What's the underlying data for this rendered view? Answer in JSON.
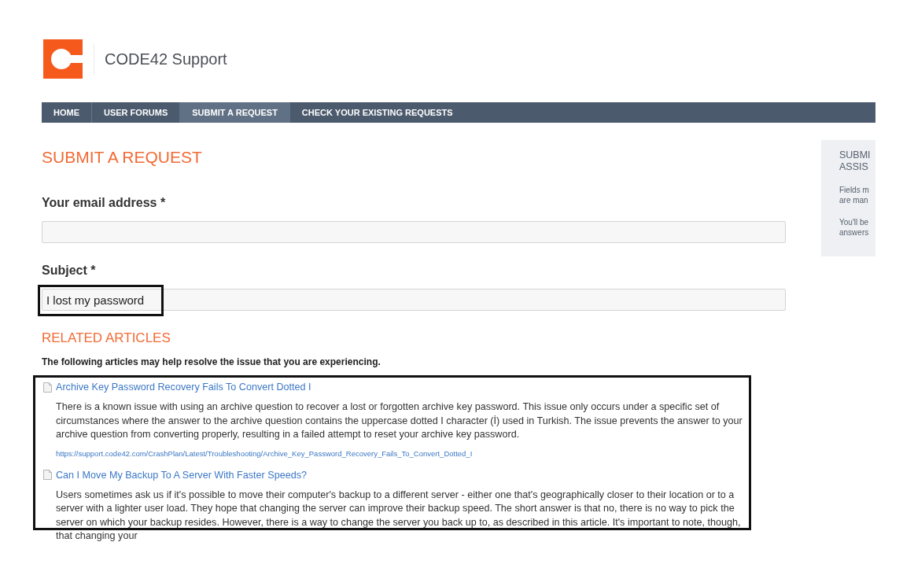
{
  "header": {
    "title": "CODE42 Support"
  },
  "nav": [
    {
      "label": "HOME",
      "selected": false
    },
    {
      "label": "USER FORUMS",
      "selected": false
    },
    {
      "label": "SUBMIT A REQUEST",
      "selected": true
    },
    {
      "label": "CHECK YOUR EXISTING REQUESTS",
      "selected": false
    }
  ],
  "form": {
    "title": "SUBMIT A REQUEST",
    "fields": [
      {
        "label": "Your email address *"
      },
      {
        "label": "Subject *",
        "value": "I lost my password",
        "highlighted": true
      }
    ]
  },
  "related_articles": {
    "title": "RELATED ARTICLES",
    "intro": "The following articles may help resolve the issue that you are experiencing.",
    "highlighted": true,
    "items": [
      {
        "title": "Archive Key Password Recovery Fails To Convert Dotted I",
        "summary": "There is a known issue with using an archive question to recover a lost or forgotten archive key password. This issue only occurs under a specific set of circumstances where the answer to the archive question contains the uppercase dotted I character (İ) used in Turkish.  The issue prevents the answer to your archive question from converting properly, resulting in a failed attempt to reset your archive key password.",
        "url": "https://support.code42.com/CrashPlan/Latest/Troubleshooting/Archive_Key_Password_Recovery_Fails_To_Convert_Dotted_I"
      },
      {
        "title": "Can I Move My Backup To A Server With Faster Speeds?",
        "summary": "Users sometimes ask us if it's possible to move their computer's backup to a different server - either one that's geographically closer to their location or to a server with a lighter user load. They hope that changing the server can improve their backup speed. The short answer is that no, there is no way to pick the server on which your backup resides. However, there is a way to change the server you back up to, as described in this article. It's important to note, though, that changing your"
      }
    ]
  },
  "sidebar": {
    "heading": [
      "SUBMI",
      "ASSIS"
    ],
    "paragraphs": [
      [
        "Fields m",
        "are man"
      ],
      [
        "You'll be",
        "answers"
      ]
    ]
  }
}
